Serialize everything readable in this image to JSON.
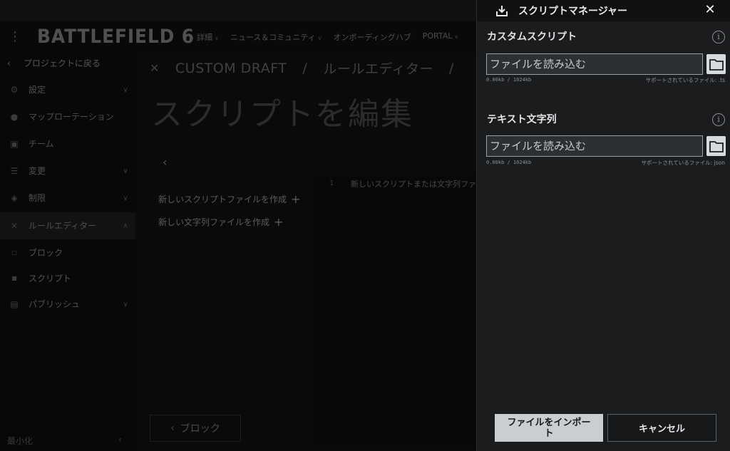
{
  "app": {
    "logo": "BATTLEFIELD 6",
    "nav": [
      {
        "label": "詳細",
        "chevron": true
      },
      {
        "label": "ニュース＆コミュニティ",
        "chevron": true
      },
      {
        "label": "オンボーディングハブ",
        "chevron": false
      },
      {
        "label": "PORTAL",
        "chevron": true
      }
    ],
    "sidebar": {
      "back_label": "プロジェクトに戻る",
      "items": [
        {
          "label": "設定",
          "icon": "gear-icon"
        },
        {
          "label": "マップローテーション",
          "icon": "map-pin-icon"
        },
        {
          "label": "チーム",
          "icon": "team-icon"
        },
        {
          "label": "変更",
          "icon": "sliders-icon"
        },
        {
          "label": "制限",
          "icon": "restriction-icon"
        },
        {
          "label": "ルールエディター",
          "icon": "rule-editor-icon"
        }
      ],
      "sub_items": [
        {
          "label": "ブロック"
        },
        {
          "label": "スクリプト"
        }
      ],
      "publish_label": "パブリッシュ",
      "minimize_label": "最小化"
    },
    "breadcrumb": [
      "CUSTOM DRAFT",
      "/",
      "ルールエディター",
      "/"
    ],
    "page_title": "スクリプトを編集",
    "create_script_label": "新しいスクリプトファイルを作成",
    "create_strings_label": "新しい文字列ファイルを作成",
    "editor_line_number": "1",
    "editor_line_text": "新しいスクリプトまたは文字列ファ",
    "block_button_label": "ブロック"
  },
  "panel": {
    "title": "スクリプトマネージャー",
    "sections": [
      {
        "title": "カスタムスクリプト",
        "placeholder": "ファイルを読み込む",
        "size": "0.00kb / 1024kb",
        "supported": "サポートされているファイル: .ts"
      },
      {
        "title": "テキスト文字列",
        "placeholder": "ファイルを読み込む",
        "size": "0.00kb / 1024kb",
        "supported": "サポートされているファイル: json"
      }
    ],
    "import_label": "ファイルをインポート",
    "cancel_label": "キャンセル"
  },
  "colors": {
    "panel_bg": "#1b1c1e",
    "header_bg": "#101112",
    "input_bg": "#2d3033",
    "primary_button": "#c9ced2"
  }
}
